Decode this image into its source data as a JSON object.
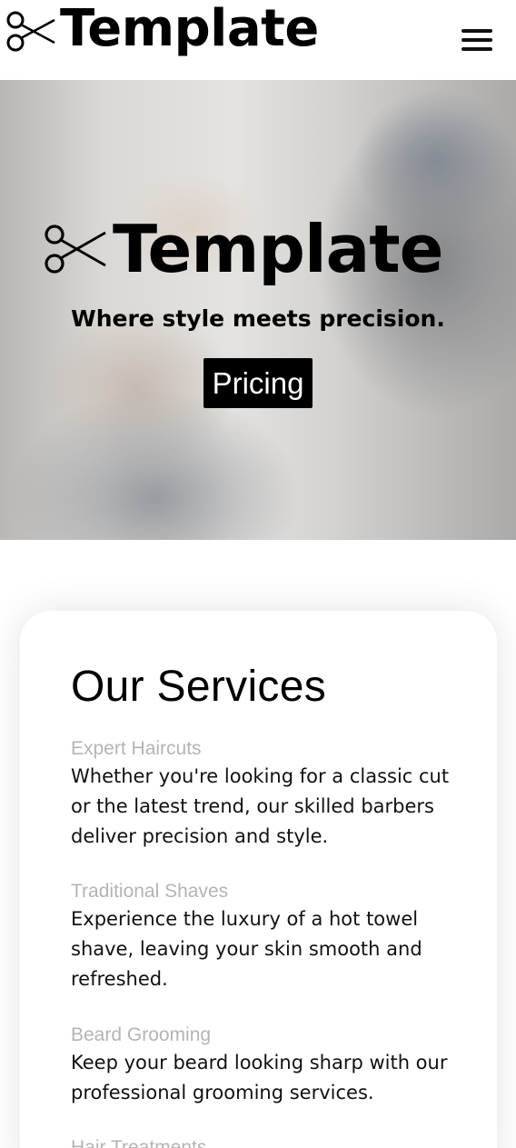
{
  "header": {
    "brand": "Template",
    "menu_icon": "hamburger-menu-icon",
    "logo_icon": "scissors-icon"
  },
  "hero": {
    "brand": "Template",
    "tagline": "Where style meets precision.",
    "cta_label": "Pricing"
  },
  "services": {
    "title": "Our Services",
    "items": [
      {
        "name": "Expert Haircuts",
        "description": "Whether you're looking for a classic cut or the latest trend, our skilled barbers deliver precision and style."
      },
      {
        "name": "Traditional Shaves",
        "description": "Experience the luxury of a hot towel shave, leaving your skin smooth and refreshed."
      },
      {
        "name": "Beard Grooming",
        "description": "Keep your beard looking sharp with our professional grooming services."
      },
      {
        "name": "Hair Treatments",
        "description": ""
      }
    ]
  },
  "colors": {
    "text": "#000000",
    "muted": "#b4b4b4",
    "button_bg": "#000000",
    "button_text": "#ffffff"
  }
}
